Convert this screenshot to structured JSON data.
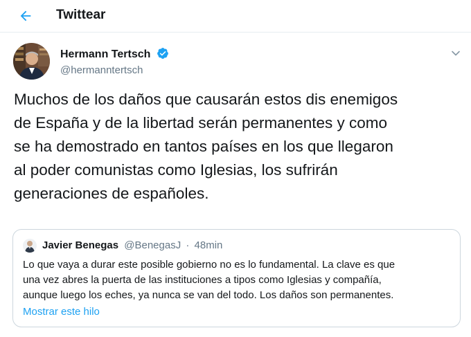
{
  "header": {
    "back_icon": "arrow-left-icon",
    "title": "Twittear"
  },
  "tweet": {
    "author": {
      "name": "Hermann Tertsch",
      "handle": "@hermanntertsch",
      "verified_icon": "verified-badge-icon"
    },
    "menu_icon": "chevron-down-icon",
    "text": "Muchos de los daños que causarán estos dis enemigos\nde España y de la libertad serán permanentes y como\nse ha demostrado en tantos países en los que llegaron\nal poder comunistas como Iglesias, los sufrirán\ngeneraciones de españoles."
  },
  "quote": {
    "name": "Javier Benegas",
    "handle": "@BenegasJ",
    "separator": "·",
    "time": "48min",
    "text": "Lo que vaya a durar este posible gobierno no es lo fundamental. La clave es que\nuna vez abres la puerta de las instituciones a tipos como Iglesias y compañía,\naunque luego los eches, ya nunca se van del todo. Los daños son permanentes.",
    "show_thread": "Mostrar este hilo"
  },
  "colors": {
    "accent": "#1da1f2",
    "text": "#14171a",
    "secondary": "#657786",
    "border": "#ccd6dd",
    "divider": "#e6ecf0"
  }
}
